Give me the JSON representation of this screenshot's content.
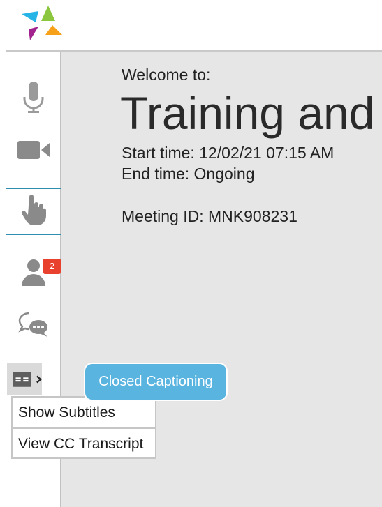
{
  "sidebar": {
    "participants_badge": "2",
    "cc_label": "CC"
  },
  "cc_menu": {
    "tooltip": "Closed Captioning",
    "items": [
      "Show Subtitles",
      "View CC Transcript"
    ]
  },
  "meeting": {
    "welcome": "Welcome to:",
    "title": "Training and",
    "start_time": "Start time: 12/02/21 07:15 AM",
    "end_time": "End time: Ongoing",
    "meeting_id": "Meeting ID: MNK908231"
  },
  "colors": {
    "accent": "#2f8fb0",
    "badge": "#e8422f",
    "tooltip": "#59b4e0",
    "main_bg": "#e6e6e6"
  }
}
